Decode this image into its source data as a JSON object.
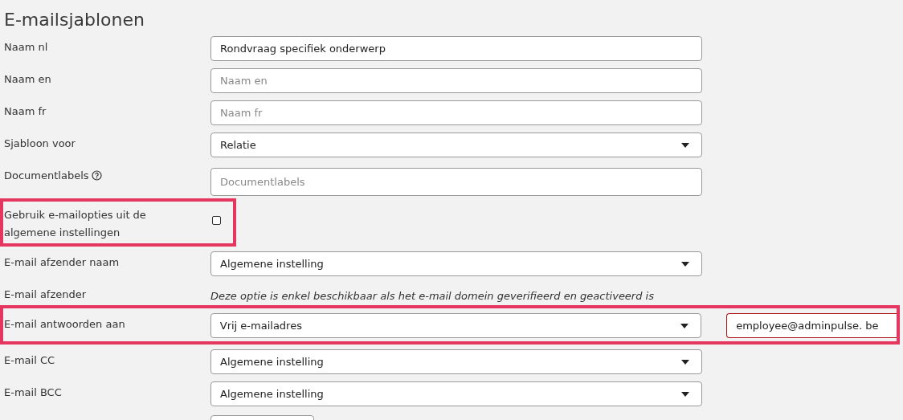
{
  "title": "E-mailsjablonen",
  "rows": [
    {
      "kind": "text",
      "label": "Naam nl",
      "value": "Rondvraag specifiek onderwerp",
      "highlighted": false
    },
    {
      "kind": "text",
      "label": "Naam en",
      "placeholder": "Naam en",
      "highlighted": false
    },
    {
      "kind": "text",
      "label": "Naam fr",
      "placeholder": "Naam fr",
      "highlighted": false
    },
    {
      "kind": "select",
      "label": "Sjabloon voor",
      "value": "Relatie",
      "highlighted": false
    },
    {
      "kind": "tags",
      "label": "Documentlabels",
      "help": true,
      "placeholder": "Documentlabels",
      "highlighted": false
    },
    {
      "kind": "checkbox",
      "label": "Gebruik e-mailopties uit de algemene instellingen",
      "checked": false,
      "highlighted": true
    },
    {
      "kind": "select",
      "label": "E-mail afzender naam",
      "value": "Algemene instelling",
      "highlighted": false
    },
    {
      "kind": "note",
      "label": "E-mail afzender",
      "note": "Deze optie is enkel beschikbaar als het e-mail domein geverifieerd en geactiveerd is",
      "highlighted": false
    },
    {
      "kind": "select",
      "label": "E-mail antwoorden aan",
      "value": "Vrij e-mailadres",
      "extra_value": "employee@adminpulse. be",
      "highlighted": true
    },
    {
      "kind": "select",
      "label": "E-mail CC",
      "value": "Algemene instelling",
      "highlighted": false
    },
    {
      "kind": "select",
      "label": "E-mail BCC",
      "value": "Algemene instelling",
      "highlighted": false
    },
    {
      "kind": "short",
      "highlighted": false
    }
  ]
}
